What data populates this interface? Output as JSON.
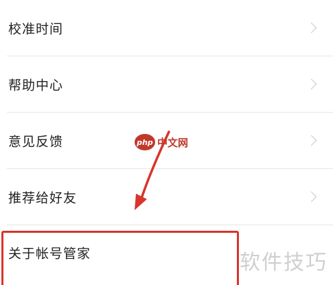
{
  "menu": {
    "items": [
      {
        "label": "校准时间",
        "has_chevron": true
      },
      {
        "label": "帮助中心",
        "has_chevron": true
      },
      {
        "label": "意见反馈",
        "has_chevron": true
      },
      {
        "label": "推荐给好友",
        "has_chevron": true
      },
      {
        "label": "关于帐号管家",
        "has_chevron": false
      }
    ]
  },
  "annotation": {
    "highlight_color": "#d8352c",
    "arrow_color": "#d8352c"
  },
  "watermarks": {
    "logo_badge": "php",
    "logo_text": "中文网",
    "corner_text": "软件技巧"
  }
}
